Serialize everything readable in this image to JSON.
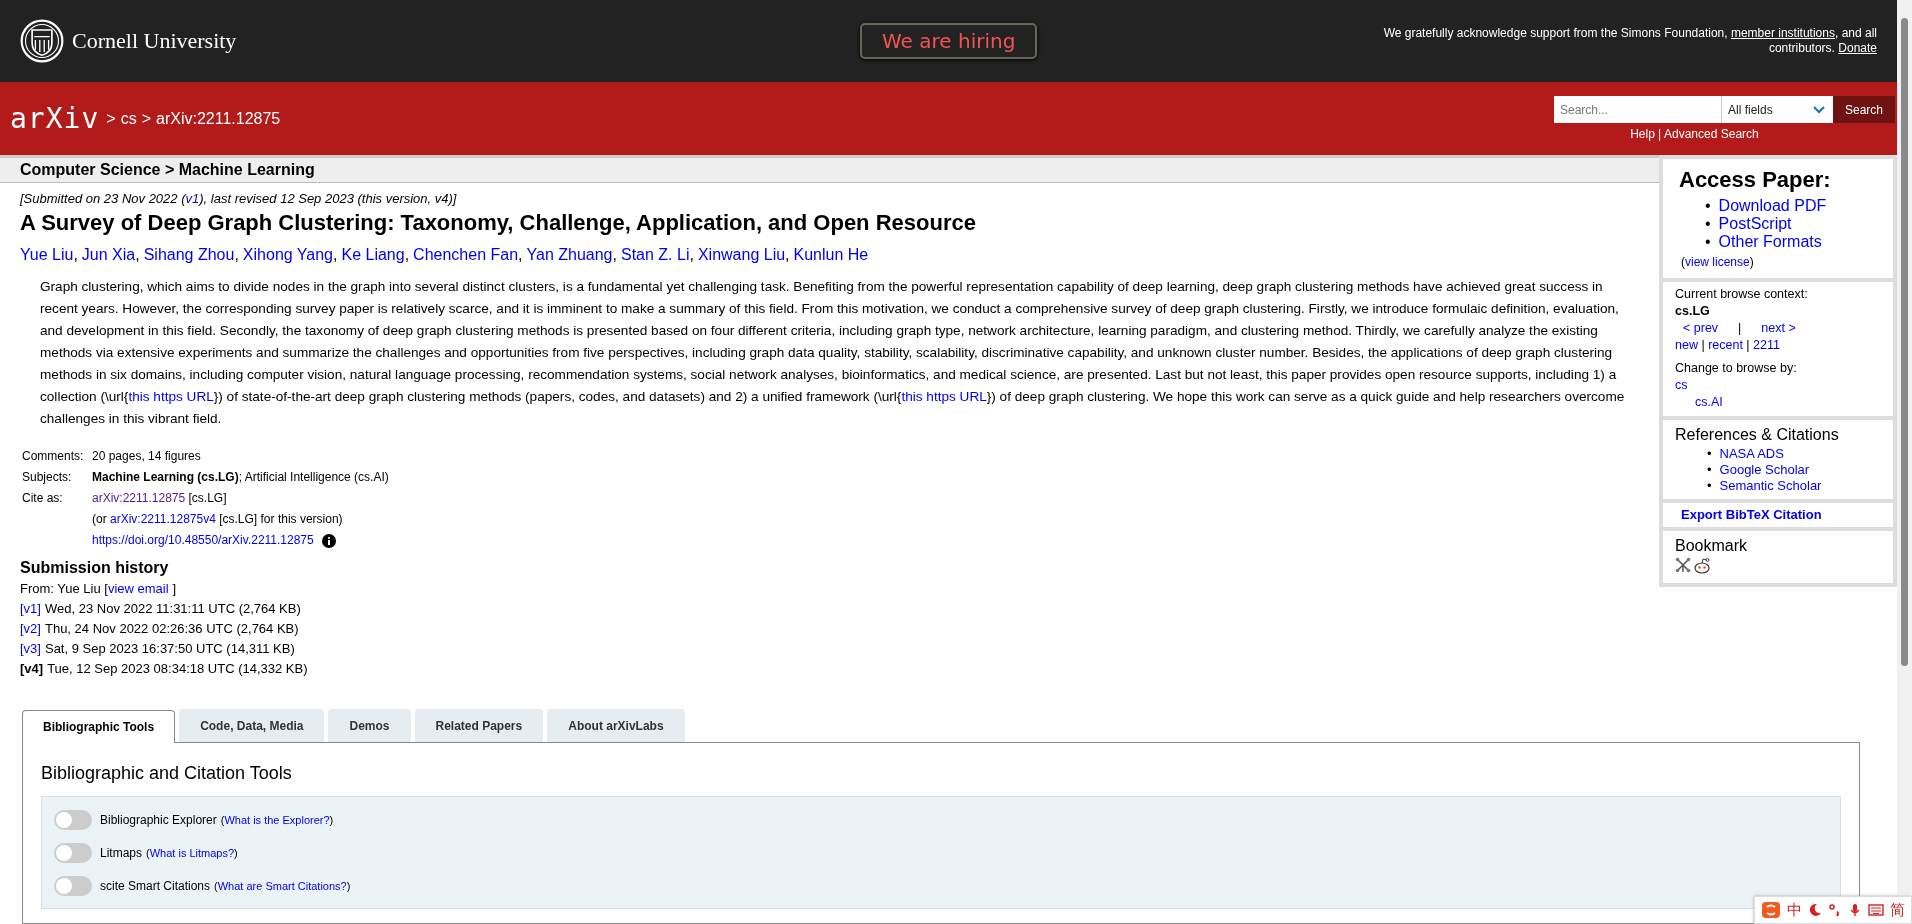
{
  "header": {
    "institution": "Cornell University",
    "hiring_button": "We are hiring",
    "support": [
      {
        "kind": "text",
        "text": "We gratefully acknowledge support from the Simons Foundation, "
      },
      {
        "kind": "link",
        "text": "member institutions"
      },
      {
        "kind": "text",
        "text": ", and all contributors. "
      },
      {
        "kind": "link",
        "text": "Donate"
      }
    ]
  },
  "nav": {
    "logo": "arXiv",
    "breadcrumb": [
      {
        "sep": ">",
        "text": "cs"
      },
      {
        "sep": ">",
        "text": "arXiv:2211.12875"
      }
    ],
    "search": {
      "placeholder": "Search...",
      "field": "All fields",
      "button": "Search",
      "help": "Help",
      "advanced": "Advanced Search",
      "divider": "|"
    }
  },
  "category_bar": "Computer Science > Machine Learning",
  "submitted": [
    {
      "kind": "text",
      "text": "[Submitted on 23 Nov 2022 ("
    },
    {
      "kind": "link",
      "text": "v1"
    },
    {
      "kind": "text",
      "text": "), last revised 12 Sep 2023 (this version, v4)]"
    }
  ],
  "title": "A Survey of Deep Graph Clustering: Taxonomy, Challenge, Application, and Open Resource",
  "authors": [
    {
      "name": "Yue Liu",
      "sep": ","
    },
    {
      "name": "Jun Xia",
      "sep": ","
    },
    {
      "name": "Sihang Zhou",
      "sep": ","
    },
    {
      "name": "Xihong Yang",
      "sep": ","
    },
    {
      "name": "Ke Liang",
      "sep": ","
    },
    {
      "name": "Chenchen Fan",
      "sep": ","
    },
    {
      "name": "Yan Zhuang",
      "sep": ","
    },
    {
      "name": "Stan Z. Li",
      "sep": ","
    },
    {
      "name": "Xinwang Liu",
      "sep": ","
    },
    {
      "name": "Kunlun He"
    }
  ],
  "abstract": [
    {
      "kind": "text",
      "text": "Graph clustering, which aims to divide nodes in the graph into several distinct clusters, is a fundamental yet challenging task. Benefiting from the powerful representation capability of deep learning, deep graph clustering methods have achieved great success in recent years. However, the corresponding survey paper is relatively scarce, and it is imminent to make a summary of this field. From this motivation, we conduct a comprehensive survey of deep graph clustering. Firstly, we introduce formulaic definition, evaluation, and development in this field. Secondly, the taxonomy of deep graph clustering methods is presented based on four different criteria, including graph type, network architecture, learning paradigm, and clustering method. Thirdly, we carefully analyze the existing methods via extensive experiments and summarize the challenges and opportunities from five perspectives, including graph data quality, stability, scalability, discriminative capability, and unknown cluster number. Besides, the applications of deep graph clustering methods in six domains, including computer vision, natural language processing, recommendation systems, social network analyses, bioinformatics, and medical science, are presented. Last but not least, this paper provides open resource supports, including 1) a collection (\\url{"
    },
    {
      "kind": "link",
      "text": "this https URL"
    },
    {
      "kind": "text",
      "text": "}) of state-of-the-art deep graph clustering methods (papers, codes, and datasets) and 2) a unified framework (\\url{"
    },
    {
      "kind": "link",
      "text": "this https URL"
    },
    {
      "kind": "text",
      "text": "}) of deep graph clustering. We hope this work can serve as a quick guide and help researchers overcome challenges in this vibrant field."
    }
  ],
  "metadata": [
    {
      "label": "Comments:",
      "lines": [
        [
          {
            "kind": "text",
            "text": "20 pages, 14 figures"
          }
        ]
      ]
    },
    {
      "label": "Subjects:",
      "lines": [
        [
          {
            "kind": "text",
            "text": "**Machine Learning (cs.LG)**; Artificial Intelligence (cs.AI)"
          }
        ]
      ]
    },
    {
      "label": "Cite as:",
      "lines": [
        [
          {
            "kind": "visited",
            "text": "arXiv:2211.12875"
          },
          {
            "kind": "text",
            "text": " [cs.LG]"
          }
        ],
        [
          {
            "kind": "text",
            "text": "(or "
          },
          {
            "kind": "link",
            "text": "arXiv:2211.12875v4"
          },
          {
            "kind": "text",
            "text": " [cs.LG] for this version)"
          }
        ],
        [
          {
            "kind": "link",
            "text": "https://doi.org/10.48550/arXiv.2211.12875"
          },
          {
            "kind": "info"
          }
        ]
      ]
    }
  ],
  "submission_history": {
    "heading": "Submission history",
    "from": [
      {
        "kind": "text",
        "text": "From: Yue Liu ["
      },
      {
        "kind": "link",
        "text": "view email"
      },
      {
        "kind": "text",
        "text": "]"
      }
    ],
    "versions": [
      {
        "label": "[v1]",
        "current": false,
        "text": "Wed, 23 Nov 2022 11:31:11 UTC (2,764 KB)"
      },
      {
        "label": "[v2]",
        "current": false,
        "text": "Thu, 24 Nov 2022 02:26:36 UTC (2,764 KB)"
      },
      {
        "label": "[v3]",
        "current": false,
        "text": "Sat, 9 Sep 2023 16:37:50 UTC (14,311 KB)"
      },
      {
        "label": "[v4]",
        "current": true,
        "text": "Tue, 12 Sep 2023 08:34:18 UTC (14,332 KB)"
      }
    ]
  },
  "sidebar": {
    "access": {
      "heading": "Access Paper:",
      "links": [
        {
          "bullet": "•",
          "text": "Download PDF"
        },
        {
          "bullet": "•",
          "text": "PostScript"
        },
        {
          "bullet": "•",
          "text": "Other Formats"
        }
      ],
      "license": [
        {
          "kind": "text",
          "text": "("
        },
        {
          "kind": "link",
          "text": "view license"
        },
        {
          "kind": "text",
          "text": ")"
        }
      ]
    },
    "browse": {
      "label": "Current browse context:",
      "context": "cs.LG",
      "prev": "< prev",
      "divider": "|",
      "next": "next >",
      "lists": [
        {
          "kind": "link",
          "text": "new"
        },
        {
          "kind": "text",
          "text": " | "
        },
        {
          "kind": "link",
          "text": "recent"
        },
        {
          "kind": "text",
          "text": " | "
        },
        {
          "kind": "link",
          "text": "2211"
        }
      ],
      "change_label": "Change to browse by:",
      "change": [
        {
          "text": "cs",
          "children": [
            {
              "text": "cs.AI"
            }
          ]
        }
      ]
    },
    "references": {
      "heading": "References & Citations",
      "links": [
        {
          "bullet": "•",
          "text": "NASA ADS"
        },
        {
          "bullet": "•",
          "text": "Google Scholar"
        },
        {
          "bullet": "•",
          "text": "Semantic Scholar"
        }
      ]
    },
    "export": "Export BibTeX Citation",
    "bookmark": {
      "heading": "Bookmark"
    }
  },
  "tabs": [
    {
      "label": "Bibliographic Tools",
      "selected": true
    },
    {
      "label": "Code, Data, Media",
      "selected": false
    },
    {
      "label": "Demos",
      "selected": false
    },
    {
      "label": "Related Papers",
      "selected": false
    },
    {
      "label": "About arXivLabs",
      "selected": false
    }
  ],
  "tab_panel": {
    "heading": "Bibliographic and Citation Tools",
    "toggles": [
      {
        "label": "Bibliographic Explorer",
        "open": "(",
        "help": "What is the Explorer?",
        "close": ")",
        "on": false
      },
      {
        "label": "Litmaps",
        "open": "(",
        "help": "What is Litmaps?",
        "close": ")",
        "on": false
      },
      {
        "label": "scite Smart Citations",
        "open": "(",
        "help": "What are Smart Citations?",
        "close": ")",
        "on": false
      }
    ]
  },
  "ime_toolbar": {
    "language": "中",
    "script": "简"
  }
}
